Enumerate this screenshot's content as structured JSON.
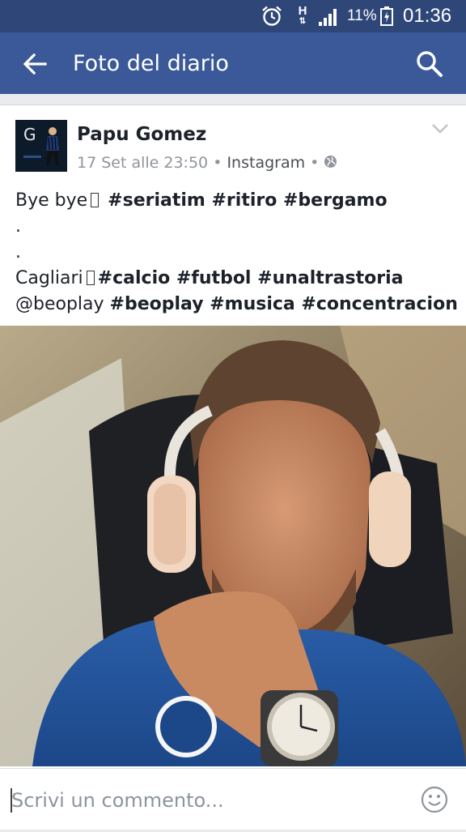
{
  "status_bar": {
    "network": "H",
    "battery_percent": "11%",
    "time": "01:36"
  },
  "header": {
    "title": "Foto del diario"
  },
  "post": {
    "author": "Papu Gomez",
    "avatar_letter": "G",
    "date": "17 Set alle 23:50",
    "separator": "•",
    "source": "Instagram",
    "text_lines": [
      {
        "plain": "Bye bye",
        "tags": "#seriatim #ritiro #bergamo"
      },
      {
        "plain": "."
      },
      {
        "plain": "."
      },
      {
        "plain": "Cagliari",
        "tags": "#calcio #futbol #unaltrastoria"
      },
      {
        "plain": "@beoplay",
        "tags": "#beoplay #musica #concentracion"
      }
    ]
  },
  "comment": {
    "placeholder": "Scrivi un commento..."
  },
  "icons": {
    "alarm": "alarm-icon",
    "signal": "signal-icon",
    "battery": "battery-icon",
    "back": "back-arrow-icon",
    "search": "search-icon",
    "chevron": "chevron-down-icon",
    "globe": "globe-icon",
    "smiley": "smiley-icon"
  },
  "colors": {
    "status_bar": "#2f4778",
    "app_bar": "#3b5998",
    "meta_text": "#90949c"
  }
}
